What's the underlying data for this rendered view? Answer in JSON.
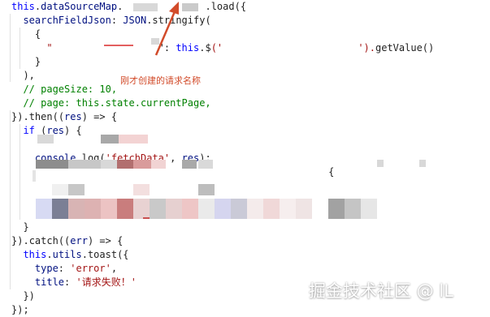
{
  "code": {
    "lines": [
      {
        "tokens": [
          {
            "text": "this",
            "cls": "kw"
          },
          {
            "text": ".",
            "cls": "punct"
          },
          {
            "text": "dataSourceMap",
            "cls": "obj"
          },
          {
            "text": ".",
            "cls": "punct"
          },
          {
            "text": "              ",
            "cls": "plain"
          },
          {
            "text": ".",
            "cls": "punct"
          },
          {
            "text": "load",
            "cls": "fn"
          },
          {
            "text": "({",
            "cls": "punct"
          }
        ]
      },
      {
        "tokens": [
          {
            "text": "  searchFieldJson",
            "cls": "obj"
          },
          {
            "text": ": ",
            "cls": "punct"
          },
          {
            "text": "JSON",
            "cls": "obj"
          },
          {
            "text": ".",
            "cls": "punct"
          },
          {
            "text": "stringify",
            "cls": "fn"
          },
          {
            "text": "(",
            "cls": "punct"
          }
        ]
      },
      {
        "tokens": [
          {
            "text": "    {",
            "cls": "punct"
          }
        ]
      },
      {
        "tokens": [
          {
            "text": "      \"",
            "cls": "str"
          },
          {
            "text": "                  ",
            "cls": "plain"
          },
          {
            "text": "\": ",
            "cls": "punct"
          },
          {
            "text": "this",
            "cls": "kw"
          },
          {
            "text": ".",
            "cls": "punct"
          },
          {
            "text": "$",
            "cls": "fn"
          },
          {
            "text": "('",
            "cls": "str"
          },
          {
            "text": "                       ",
            "cls": "plain"
          },
          {
            "text": "').",
            "cls": "str"
          },
          {
            "text": "getValue",
            "cls": "fn"
          },
          {
            "text": "()",
            "cls": "punct"
          }
        ]
      },
      {
        "tokens": [
          {
            "text": "    }",
            "cls": "punct"
          }
        ]
      },
      {
        "tokens": [
          {
            "text": "  ),",
            "cls": "punct"
          }
        ]
      },
      {
        "tokens": [
          {
            "text": "  // pageSize: 10,",
            "cls": "cmt"
          }
        ]
      },
      {
        "tokens": [
          {
            "text": "  // page: this.state.currentPage,",
            "cls": "cmt"
          }
        ]
      },
      {
        "tokens": [
          {
            "text": "})",
            "cls": "punct"
          },
          {
            "text": ".",
            "cls": "punct"
          },
          {
            "text": "then",
            "cls": "fn"
          },
          {
            "text": "((",
            "cls": "punct"
          },
          {
            "text": "res",
            "cls": "obj"
          },
          {
            "text": ") => {",
            "cls": "punct"
          }
        ]
      },
      {
        "tokens": [
          {
            "text": "  if",
            "cls": "kw"
          },
          {
            "text": " (",
            "cls": "punct"
          },
          {
            "text": "res",
            "cls": "obj"
          },
          {
            "text": ") {",
            "cls": "punct"
          }
        ]
      },
      {
        "tokens": [
          {
            "text": "    ",
            "cls": "plain"
          }
        ]
      },
      {
        "tokens": [
          {
            "text": "    console",
            "cls": "obj"
          },
          {
            "text": ".",
            "cls": "punct"
          },
          {
            "text": "log",
            "cls": "fn"
          },
          {
            "text": "(",
            "cls": "punct"
          },
          {
            "text": "'fetchData'",
            "cls": "str"
          },
          {
            "text": ", ",
            "cls": "punct"
          },
          {
            "text": "res",
            "cls": "obj"
          },
          {
            "text": ");",
            "cls": "punct"
          }
        ]
      },
      {
        "tokens": [
          {
            "text": "    ",
            "cls": "plain"
          },
          {
            "text": "                                                  {",
            "cls": "punct"
          }
        ]
      },
      {
        "tokens": [
          {
            "text": "    ",
            "cls": "plain"
          }
        ]
      },
      {
        "tokens": [
          {
            "text": "    ",
            "cls": "plain"
          }
        ]
      },
      {
        "tokens": [
          {
            "text": "    ",
            "cls": "plain"
          }
        ]
      },
      {
        "tokens": [
          {
            "text": "  }",
            "cls": "punct"
          }
        ]
      },
      {
        "tokens": [
          {
            "text": "})",
            "cls": "punct"
          },
          {
            "text": ".",
            "cls": "punct"
          },
          {
            "text": "catch",
            "cls": "fn"
          },
          {
            "text": "((",
            "cls": "punct"
          },
          {
            "text": "err",
            "cls": "obj"
          },
          {
            "text": ") => {",
            "cls": "punct"
          }
        ]
      },
      {
        "tokens": [
          {
            "text": "  this",
            "cls": "kw"
          },
          {
            "text": ".",
            "cls": "punct"
          },
          {
            "text": "utils",
            "cls": "obj"
          },
          {
            "text": ".",
            "cls": "punct"
          },
          {
            "text": "toast",
            "cls": "fn"
          },
          {
            "text": "({",
            "cls": "punct"
          }
        ]
      },
      {
        "tokens": [
          {
            "text": "    type",
            "cls": "obj"
          },
          {
            "text": ": ",
            "cls": "punct"
          },
          {
            "text": "'error'",
            "cls": "str"
          },
          {
            "text": ",",
            "cls": "punct"
          }
        ]
      },
      {
        "tokens": [
          {
            "text": "    title",
            "cls": "obj"
          },
          {
            "text": ": ",
            "cls": "punct"
          },
          {
            "text": "'请求失败！'",
            "cls": "str"
          }
        ]
      },
      {
        "tokens": [
          {
            "text": "  })",
            "cls": "punct"
          }
        ]
      },
      {
        "tokens": [
          {
            "text": "});",
            "cls": "punct"
          }
        ]
      }
    ]
  },
  "annotation": {
    "text": "刚才创建的请求名称",
    "color": "#d24b2a"
  },
  "watermark": {
    "text": "掘金技术社区 @ lL"
  },
  "colors": {
    "keyword": "#0000ff",
    "string": "#a31515",
    "comment": "#008000",
    "property": "#001080",
    "guide": "#e1e1e1"
  }
}
